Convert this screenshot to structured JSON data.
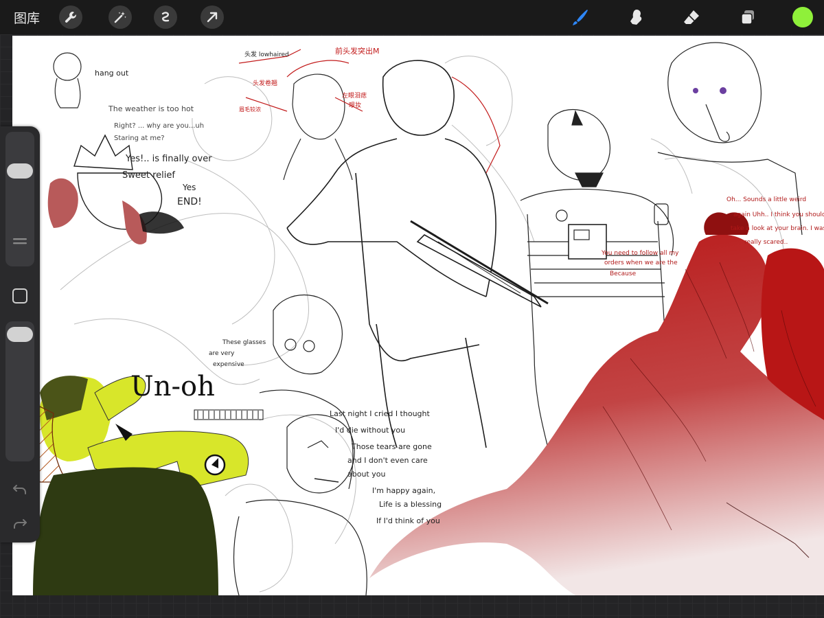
{
  "toolbar": {
    "gallery_label": "图库",
    "left_tools": [
      "wrench-icon",
      "magic-wand-icon",
      "selection-icon",
      "transform-arrow-icon"
    ],
    "right_tools": [
      "brush-icon",
      "smudge-icon",
      "eraser-icon",
      "layers-icon"
    ],
    "active_tool": "brush",
    "color_swatch": "#8ff03a",
    "accent": "#2e86f5"
  },
  "sidebar": {
    "brush_size_level": 0.15,
    "opacity_level": 0.1,
    "items": [
      "size-slider",
      "modify-button",
      "square-button",
      "opacity-slider",
      "undo-button",
      "redo-button"
    ]
  },
  "artwork": {
    "texts": {
      "hang_out": "hang out",
      "weather": "The weather is too hot",
      "right": "Right? ... why are you...uh",
      "staring": "Staring at me?",
      "yes_finally": "Yes!.. is finally over",
      "sweet_relief": "Sweet relief",
      "yes": "Yes",
      "end": "END!",
      "glasses_1": "These glasses",
      "glasses_2": "are very",
      "glasses_3": "expensive",
      "unoh": "Un-oh",
      "lyric_1": "Last night I cried I thought",
      "lyric_2": "I'd die without you",
      "lyric_3": "Those tears are gone",
      "lyric_4": "and I don't even care",
      "lyric_5": "about you",
      "lyric_6": "I'm happy again,",
      "lyric_7": "Life is a blessing",
      "lyric_8": "If I'd think of you",
      "red_1": "Oh... Sounds a little weird",
      "red_2": "again Uhh.. I think you should",
      "red_3": "take a look at your brain. I was",
      "red_4": "really scared..",
      "red_5": "You need to follow all my",
      "red_6": "orders when we are the",
      "red_7": "Because"
    },
    "palette": {
      "red": "#b81616",
      "yellow": "#d8e62a",
      "dark_green": "#2e3a12"
    }
  }
}
